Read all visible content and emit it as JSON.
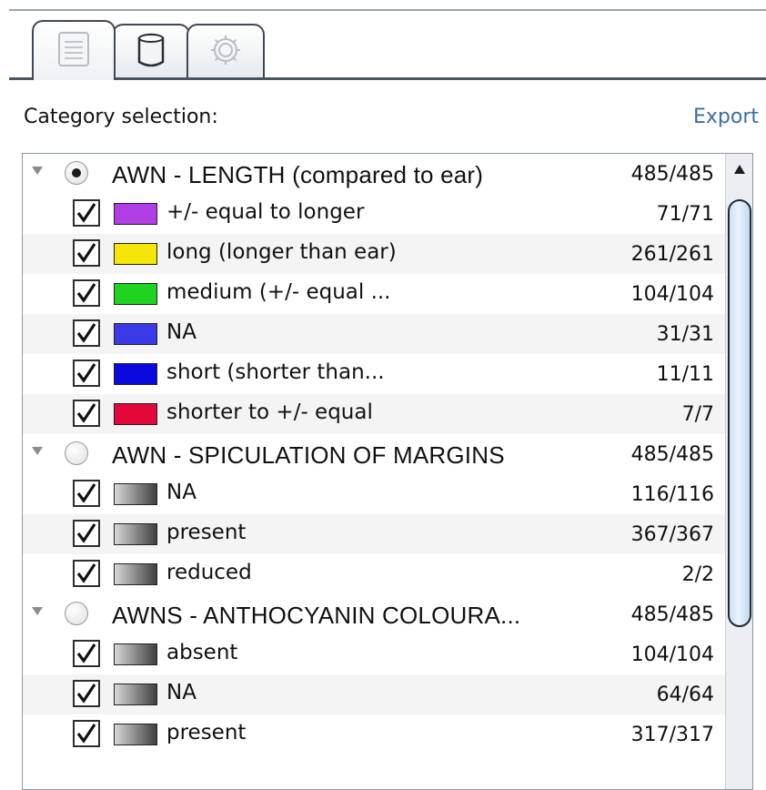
{
  "tabs": [
    {
      "icon": "list-icon",
      "active": true
    },
    {
      "icon": "database-icon",
      "active": false
    },
    {
      "icon": "gear-icon",
      "active": false
    }
  ],
  "panel": {
    "label": "Category selection:",
    "export_label": "Export"
  },
  "colors": {
    "accent_link": "#3a6ea5",
    "thumb": "#cfe3f4"
  },
  "groups": [
    {
      "name": "AWN - LENGTH (compared to ear)",
      "count": "485/485",
      "selected": true,
      "items": [
        {
          "name": "+/- equal to longer",
          "count": "71/71",
          "color": "#b23fe6",
          "checked": true
        },
        {
          "name": "long (longer than ear)",
          "count": "261/261",
          "color": "#f5e60a",
          "checked": true
        },
        {
          "name": "medium (+/- equal ...",
          "count": "104/104",
          "color": "#1fd31f",
          "checked": true
        },
        {
          "name": "NA",
          "count": "31/31",
          "color": "#3a3ae6",
          "checked": true
        },
        {
          "name": "short (shorter than...",
          "count": "11/11",
          "color": "#0a0ae0",
          "checked": true
        },
        {
          "name": "shorter to +/- equal",
          "count": "7/7",
          "color": "#e4073a",
          "checked": true
        }
      ]
    },
    {
      "name": "AWN - SPICULATION OF MARGINS",
      "count": "485/485",
      "selected": false,
      "items": [
        {
          "name": "NA",
          "count": "116/116",
          "color": "gray",
          "checked": true
        },
        {
          "name": "present",
          "count": "367/367",
          "color": "gray",
          "checked": true
        },
        {
          "name": "reduced",
          "count": "2/2",
          "color": "gray",
          "checked": true
        }
      ]
    },
    {
      "name": "AWNS - ANTHOCYANIN COLOURA...",
      "count": "485/485",
      "selected": false,
      "items": [
        {
          "name": "absent",
          "count": "104/104",
          "color": "gray",
          "checked": true
        },
        {
          "name": "NA",
          "count": "64/64",
          "color": "gray",
          "checked": true
        },
        {
          "name": "present",
          "count": "317/317",
          "color": "gray",
          "checked": true
        }
      ]
    }
  ]
}
